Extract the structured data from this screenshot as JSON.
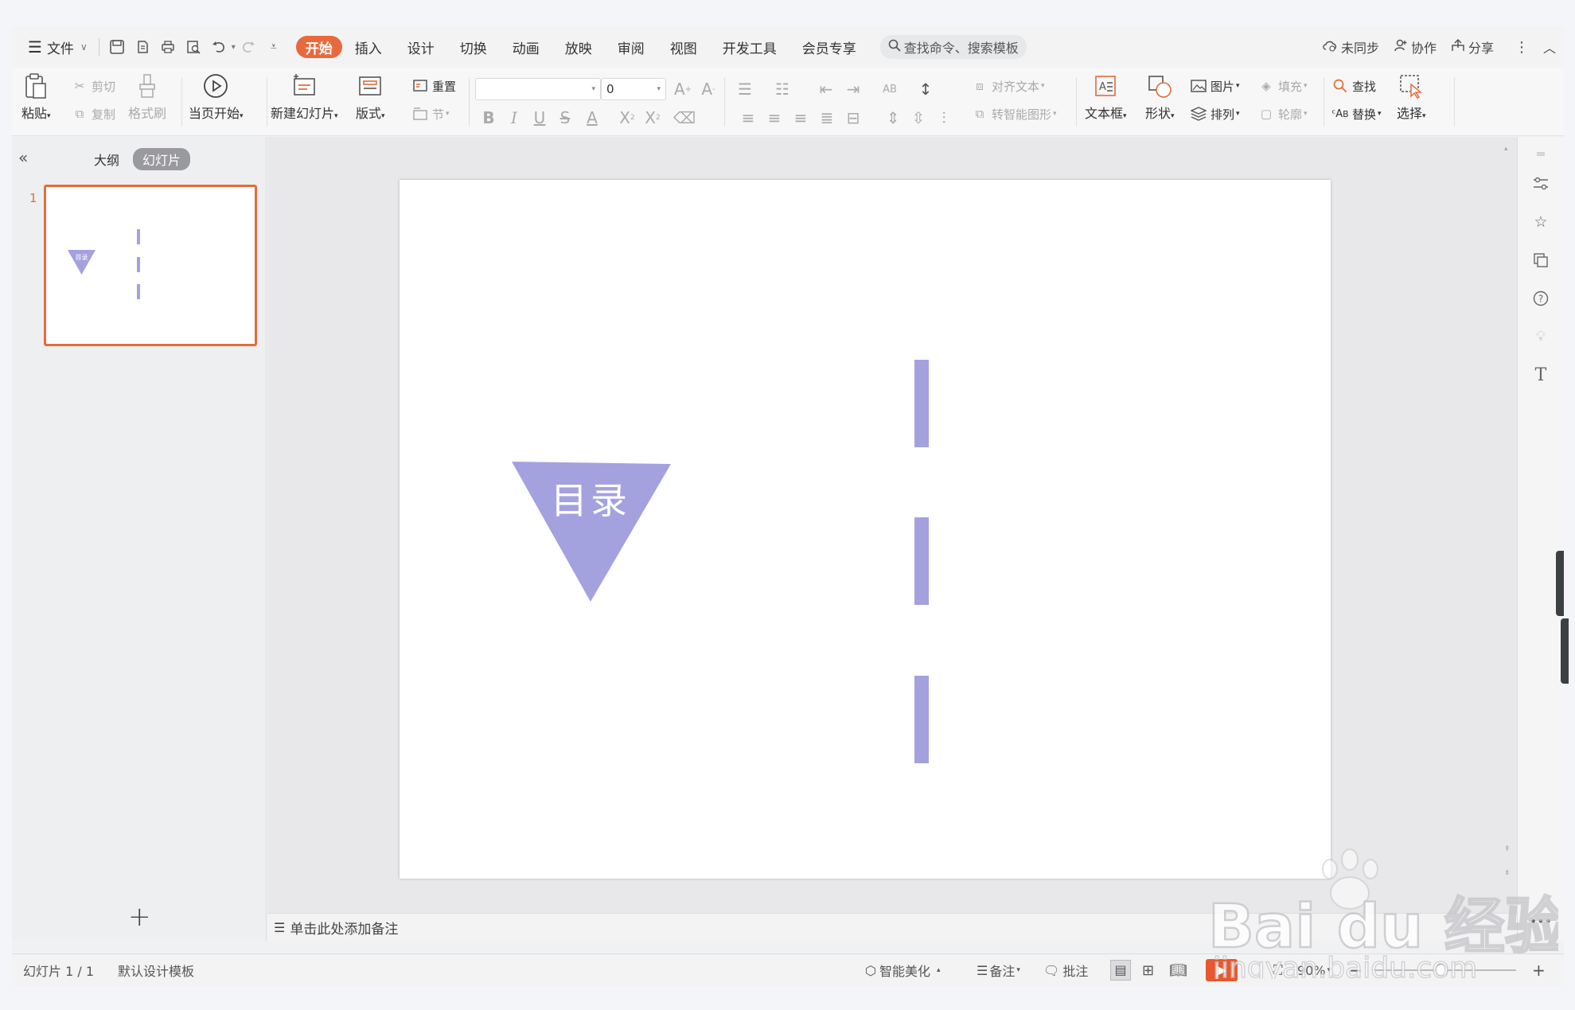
{
  "menu": {
    "file_label": "文件",
    "tabs": [
      "开始",
      "插入",
      "设计",
      "切换",
      "动画",
      "放映",
      "审阅",
      "视图",
      "开发工具",
      "会员专享"
    ],
    "search_placeholder": "查找命令、搜索模板",
    "right": {
      "sync": "未同步",
      "collab": "协作",
      "share": "分享"
    }
  },
  "ribbon": {
    "paste": "粘贴",
    "cut": "剪切",
    "copy": "复制",
    "format_painter": "格式刷",
    "play_current": "当页开始",
    "new_slide": "新建幻灯片",
    "layout": "版式",
    "reset": "重置",
    "section": "节",
    "font_size": "0",
    "align_text": "对齐文本",
    "smart_art": "转智能图形",
    "textbox": "文本框",
    "shape": "形状",
    "picture": "图片",
    "fill": "填充",
    "arrange": "排列",
    "outline": "轮廓",
    "find": "查找",
    "replace": "替换",
    "select": "选择"
  },
  "left_panel": {
    "tab_outline": "大纲",
    "tab_slides": "幻灯片",
    "slide_number": "1"
  },
  "slide": {
    "title_text": "目录",
    "thumb_title_text": "目录",
    "accent_color": "#a4a1df"
  },
  "notes_placeholder": "单击此处添加备注",
  "status": {
    "slide_count": "幻灯片 1 / 1",
    "template": "默认设计模板",
    "beautify": "智能美化",
    "notes": "备注",
    "comments": "批注",
    "zoom": "90%"
  },
  "watermark": {
    "brand": "Bai du 经验",
    "url": "jingyan.baidu.com"
  }
}
